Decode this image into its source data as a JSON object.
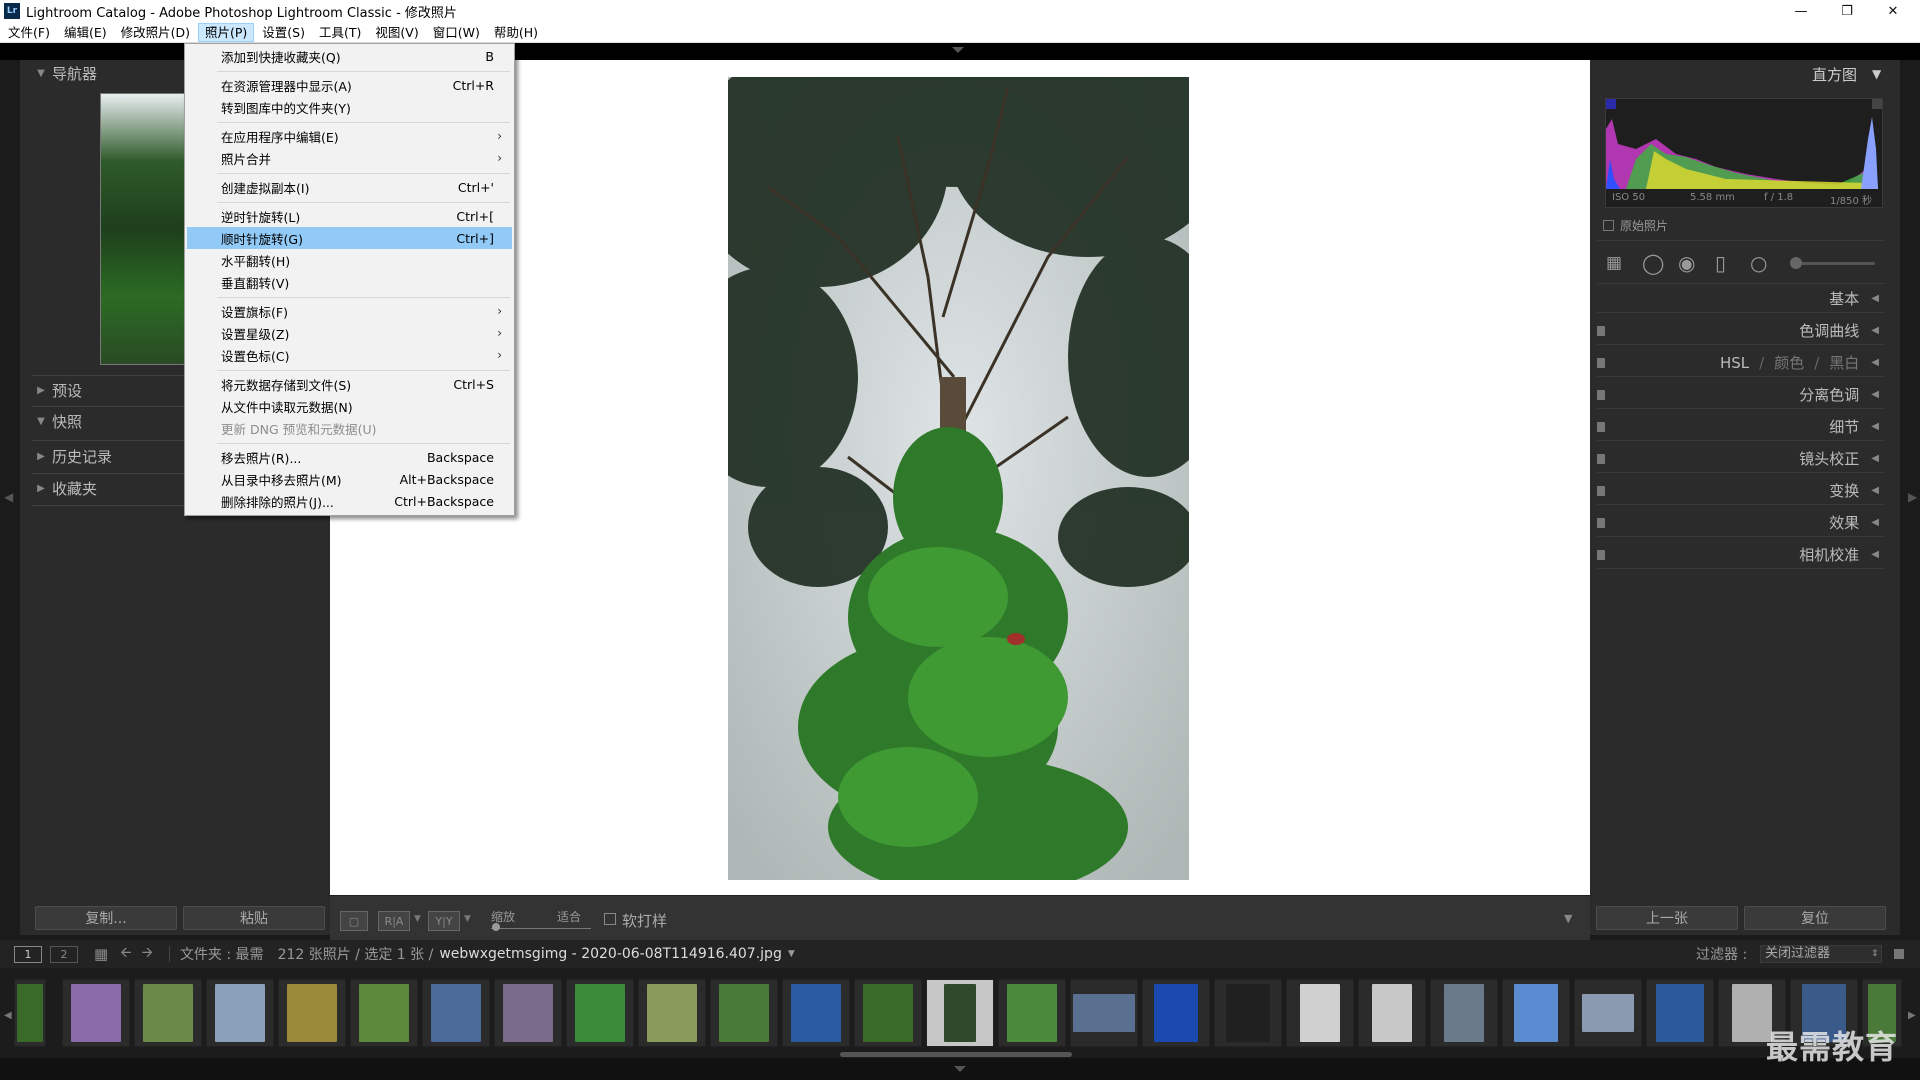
{
  "window": {
    "title": "Lightroom Catalog - Adobe Photoshop Lightroom Classic - 修改照片",
    "app_badge": "Lr"
  },
  "menubar": [
    "文件(F)",
    "编辑(E)",
    "修改照片(D)",
    "照片(P)",
    "设置(S)",
    "工具(T)",
    "视图(V)",
    "窗口(W)",
    "帮助(H)"
  ],
  "dropdown": [
    {
      "label": "添加到快捷收藏夹(Q)",
      "shortcut": "B"
    },
    {
      "label": "在资源管理器中显示(A)",
      "shortcut": "Ctrl+R"
    },
    {
      "label": "转到图库中的文件夹(Y)",
      "shortcut": ""
    },
    {
      "label": "在应用程序中编辑(E)",
      "shortcut": ""
    },
    {
      "label": "照片合并",
      "shortcut": ""
    },
    {
      "label": "创建虚拟副本(I)",
      "shortcut": "Ctrl+'"
    },
    {
      "label": "逆时针旋转(L)",
      "shortcut": "Ctrl+["
    },
    {
      "label": "顺时针旋转(G)",
      "shortcut": "Ctrl+]"
    },
    {
      "label": "水平翻转(H)",
      "shortcut": ""
    },
    {
      "label": "垂直翻转(V)",
      "shortcut": ""
    },
    {
      "label": "设置旗标(F)",
      "shortcut": ""
    },
    {
      "label": "设置星级(Z)",
      "shortcut": ""
    },
    {
      "label": "设置色标(C)",
      "shortcut": ""
    },
    {
      "label": "将元数据存储到文件(S)",
      "shortcut": "Ctrl+S"
    },
    {
      "label": "从文件中读取元数据(N)",
      "shortcut": ""
    },
    {
      "label": "更新 DNG 预览和元数据(U)",
      "shortcut": ""
    },
    {
      "label": "移去照片(R)...",
      "shortcut": "Backspace"
    },
    {
      "label": "从目录中移去照片(M)",
      "shortcut": "Alt+Backspace"
    },
    {
      "label": "删除排除的照片(J)...",
      "shortcut": "Ctrl+Backspace"
    }
  ],
  "left_panel": {
    "navigator": "导航器",
    "presets": "预设",
    "snapshots": "快照",
    "history": "历史记录",
    "collections": "收藏夹",
    "copy_btn": "复制...",
    "paste_btn": "粘贴"
  },
  "right_panel": {
    "histogram_title": "直方图",
    "exif": {
      "iso": "ISO 50",
      "focal": "5.58 mm",
      "aperture": "f / 1.8",
      "shutter": "1/850 秒"
    },
    "original_photo": "原始照片",
    "sections": [
      "基本",
      "色调曲线",
      "细节",
      "镜头校正",
      "变换",
      "效果",
      "相机校准"
    ],
    "hsl": {
      "a": "HSL",
      "b": "颜色",
      "c": "黑白",
      "sep": "/"
    },
    "split_toning": "分离色调",
    "prev_btn": "上一张",
    "reset_btn": "复位"
  },
  "toolbar": {
    "zoom_label": "缩放",
    "fit_label": "适合",
    "softproof_label": "软打样",
    "compare_a": "R|A",
    "compare_b": "Y|Y"
  },
  "filmbar": {
    "page1": "1",
    "page2": "2",
    "source": "文件夹 : 最需",
    "count": "212 张照片 / 选定 1 张 /",
    "filename": "webwxgetmsgimg - 2020-06-08T114916.407.jpg",
    "filter_label": "过滤器 :",
    "filter_value": "关闭过滤器"
  },
  "watermark": "最需教育",
  "colors": {
    "highlight": "#91c9f7",
    "panel": "#2b2b2b",
    "background": "#1b1b1b"
  }
}
